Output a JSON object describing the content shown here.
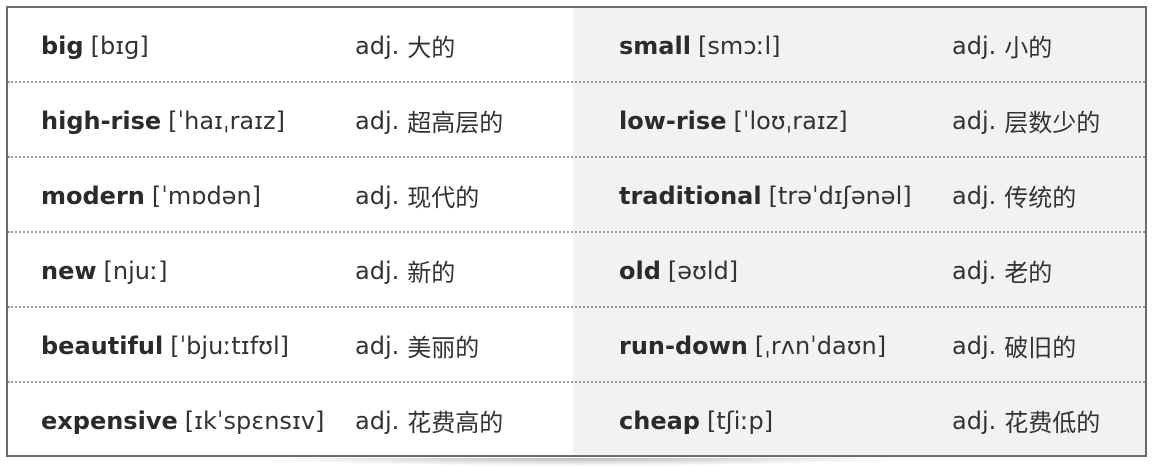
{
  "vocab": {
    "rows": [
      {
        "left": {
          "word": "big",
          "phonetic": "[bɪɡ]",
          "pos": "adj.",
          "meaning": "大的"
        },
        "right": {
          "word": "small",
          "phonetic": "[smɔːl]",
          "pos": "adj.",
          "meaning": "小的"
        }
      },
      {
        "left": {
          "word": "high-rise",
          "phonetic": "[ˈhaɪˌraɪz]",
          "pos": "adj.",
          "meaning": "超高层的"
        },
        "right": {
          "word": "low-rise",
          "phonetic": "[ˈloʊˌraɪz]",
          "pos": "adj.",
          "meaning": "层数少的"
        }
      },
      {
        "left": {
          "word": "modern",
          "phonetic": "[ˈmɒdən]",
          "pos": "adj.",
          "meaning": "现代的"
        },
        "right": {
          "word": "traditional",
          "phonetic": "[trəˈdɪʃənəl]",
          "pos": "adj.",
          "meaning": "传统的"
        }
      },
      {
        "left": {
          "word": "new",
          "phonetic": "[njuː]",
          "pos": "adj.",
          "meaning": "新的"
        },
        "right": {
          "word": "old",
          "phonetic": "[əʊld]",
          "pos": "adj.",
          "meaning": "老的"
        }
      },
      {
        "left": {
          "word": "beautiful",
          "phonetic": "[ˈbjuːtɪfʊl]",
          "pos": "adj.",
          "meaning": "美丽的"
        },
        "right": {
          "word": "run-down",
          "phonetic": "[ˌrʌnˈdaʊn]",
          "pos": "adj.",
          "meaning": "破旧的"
        }
      },
      {
        "left": {
          "word": "expensive",
          "phonetic": "[ɪkˈspɛnsɪv]",
          "pos": "adj.",
          "meaning": "花费高的"
        },
        "right": {
          "word": "cheap",
          "phonetic": "[tʃiːp]",
          "pos": "adj.",
          "meaning": "花费低的"
        }
      }
    ]
  }
}
